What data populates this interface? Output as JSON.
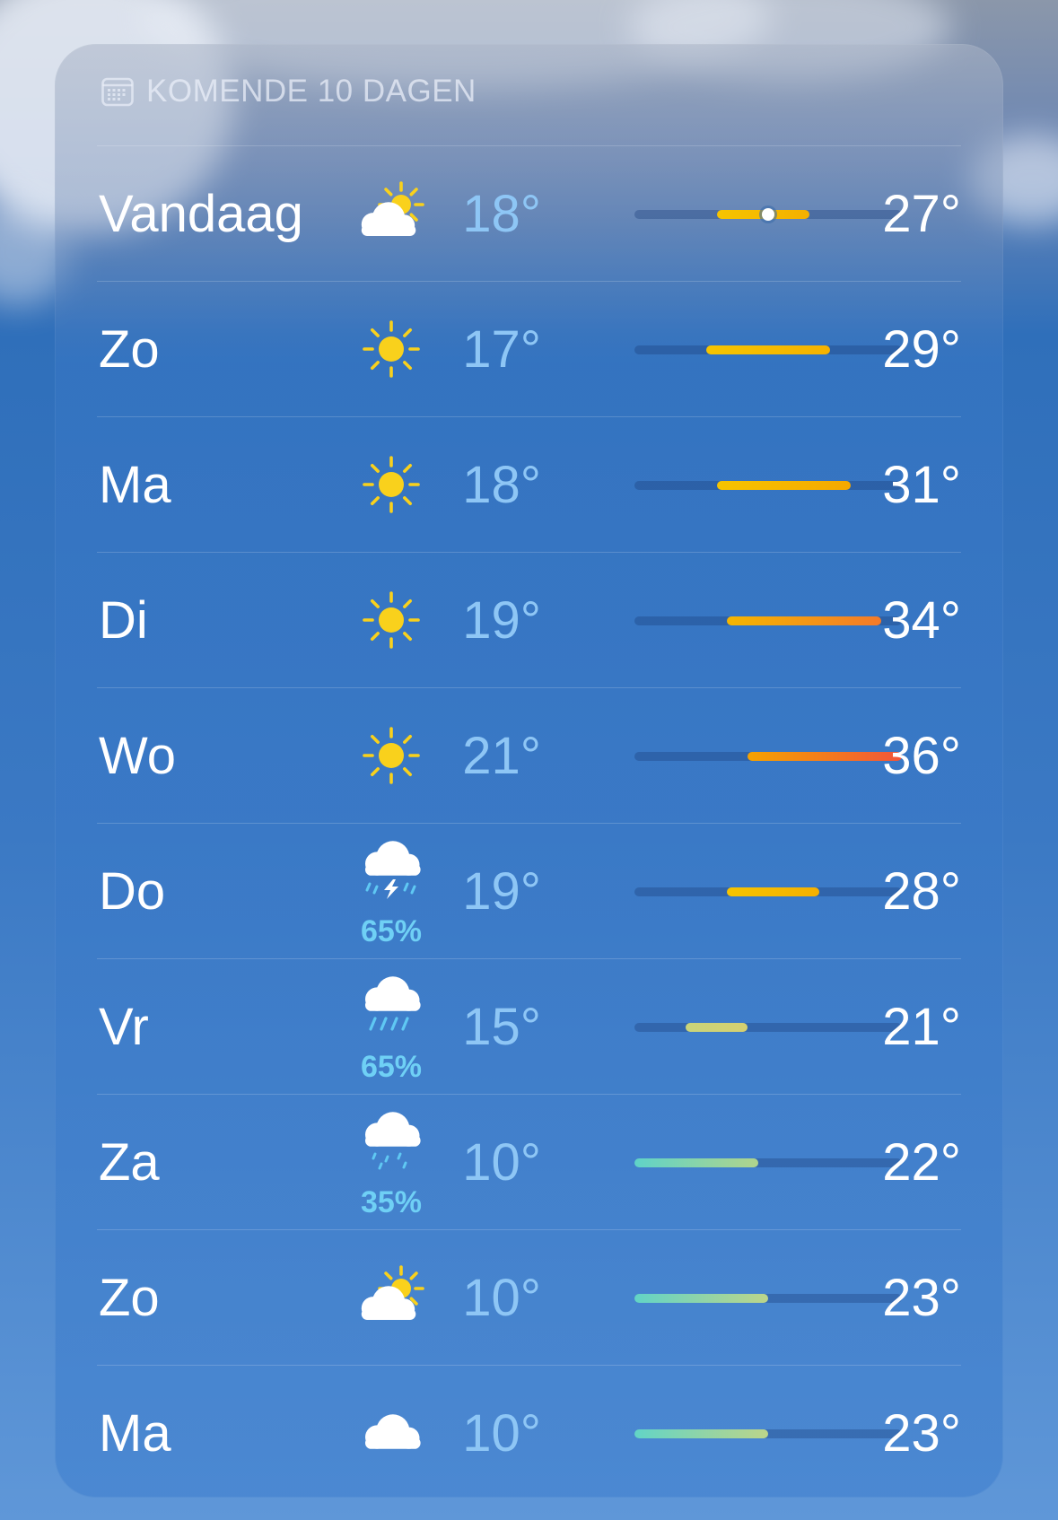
{
  "header": {
    "title": "KOMENDE 10 DAGEN",
    "icon": "calendar-icon"
  },
  "scale": {
    "min": 10,
    "max": 36
  },
  "days": [
    {
      "day": "Vandaag",
      "icon": "partly-sunny-icon",
      "precip": "",
      "low_label": "18°",
      "high_label": "27°",
      "low": 18,
      "high": 27,
      "current": 23,
      "gradient": [
        "#f6c400",
        "#f5b000"
      ]
    },
    {
      "day": "Zo",
      "icon": "sun-icon",
      "precip": "",
      "low_label": "17°",
      "high_label": "29°",
      "low": 17,
      "high": 29,
      "gradient": [
        "#f6c400",
        "#f5b200"
      ]
    },
    {
      "day": "Ma",
      "icon": "sun-icon",
      "precip": "",
      "low_label": "18°",
      "high_label": "31°",
      "low": 18,
      "high": 31,
      "gradient": [
        "#f6c400",
        "#f5a800"
      ]
    },
    {
      "day": "Di",
      "icon": "sun-icon",
      "precip": "",
      "low_label": "19°",
      "high_label": "34°",
      "low": 19,
      "high": 34,
      "gradient": [
        "#f5b600",
        "#f47a2a"
      ]
    },
    {
      "day": "Wo",
      "icon": "sun-icon",
      "precip": "",
      "low_label": "21°",
      "high_label": "36°",
      "low": 21,
      "high": 36,
      "gradient": [
        "#f5a200",
        "#f2553a"
      ]
    },
    {
      "day": "Do",
      "icon": "thunderstorm-icon",
      "precip": "65%",
      "low_label": "19°",
      "high_label": "28°",
      "low": 19,
      "high": 28,
      "gradient": [
        "#f6c400",
        "#f5b000"
      ]
    },
    {
      "day": "Vr",
      "icon": "rain-icon",
      "precip": "65%",
      "low_label": "15°",
      "high_label": "21°",
      "low": 15,
      "high": 21,
      "gradient": [
        "#c9d47a",
        "#d6d070"
      ]
    },
    {
      "day": "Za",
      "icon": "drizzle-icon",
      "precip": "35%",
      "low_label": "10°",
      "high_label": "22°",
      "low": 10,
      "high": 22,
      "gradient": [
        "#5fd3c8",
        "#b0d48c"
      ]
    },
    {
      "day": "Zo",
      "icon": "partly-sunny-icon",
      "precip": "",
      "low_label": "10°",
      "high_label": "23°",
      "low": 10,
      "high": 23,
      "gradient": [
        "#62d4c6",
        "#bcd58a"
      ]
    },
    {
      "day": "Ma",
      "icon": "cloud-icon",
      "precip": "",
      "low_label": "10°",
      "high_label": "23°",
      "low": 10,
      "high": 23,
      "gradient": [
        "#62d4c6",
        "#bcd58a"
      ]
    }
  ]
}
